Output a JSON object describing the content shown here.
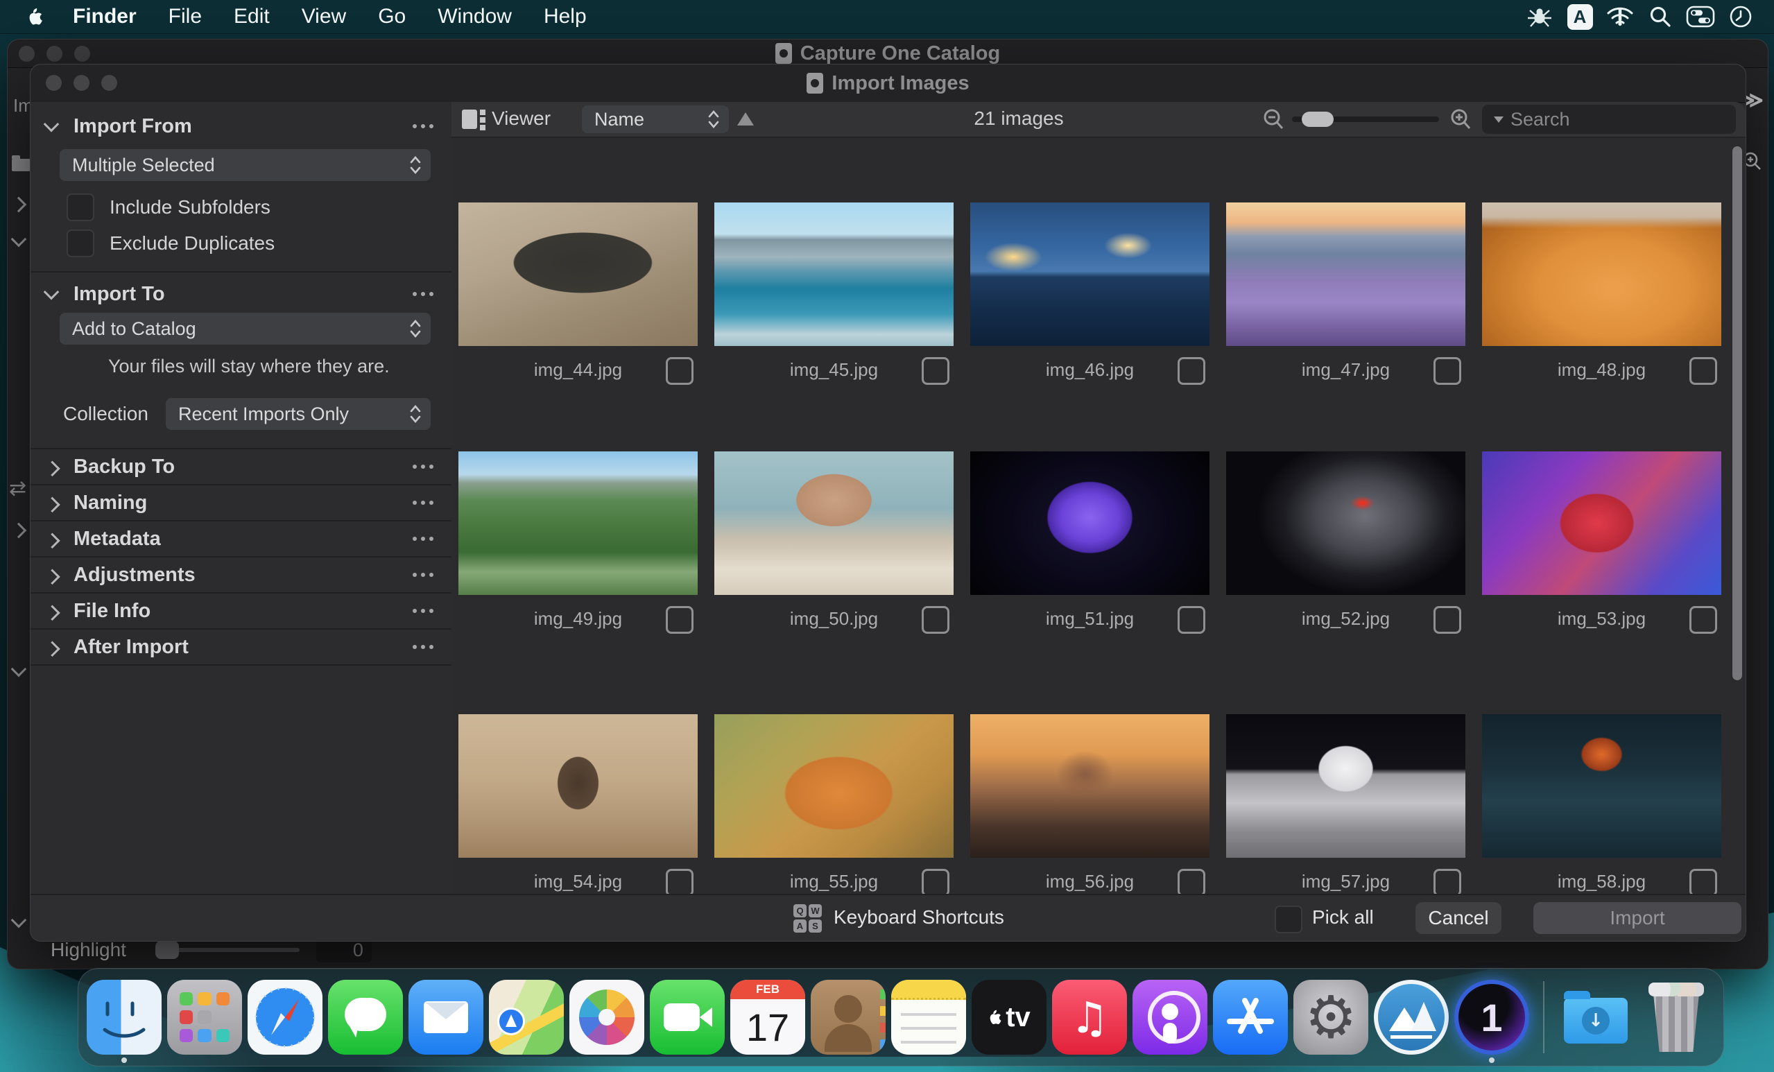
{
  "menu_bar": {
    "app_name": "Finder",
    "menus": [
      "File",
      "Edit",
      "View",
      "Go",
      "Window",
      "Help"
    ],
    "status_icons": [
      "drweb-spider-icon",
      "input-source-icon",
      "wifi-alert-icon",
      "spotlight-icon",
      "control-center-icon",
      "clock-icon"
    ]
  },
  "background_window": {
    "title": "Capture One Catalog",
    "left_rail_partial_label": "Im",
    "collapse_glyph": "≫",
    "swap_glyph": "⇄",
    "highlight": {
      "label": "Highlight",
      "value": "0"
    }
  },
  "dialog": {
    "title": "Import Images",
    "sidebar": {
      "import_from": {
        "title": "Import From",
        "source_value": "Multiple Selected",
        "include_subfolders_label": "Include Subfolders",
        "exclude_duplicates_label": "Exclude Duplicates"
      },
      "import_to": {
        "title": "Import To",
        "destination_value": "Add to Catalog",
        "note": "Your files will stay where they are.",
        "collection_label": "Collection",
        "collection_value": "Recent Imports Only"
      },
      "sections": [
        {
          "label": "Backup To"
        },
        {
          "label": "Naming"
        },
        {
          "label": "Metadata"
        },
        {
          "label": "Adjustments"
        },
        {
          "label": "File Info"
        },
        {
          "label": "After Import"
        }
      ]
    },
    "toolbar": {
      "viewer_label": "Viewer",
      "sort_by": "Name",
      "image_count": "21 images",
      "search_placeholder": "Search"
    },
    "grid": {
      "items": [
        {
          "name": "img_44.jpg",
          "bg": "radial-gradient(55% 40% at 52% 42%, #35332f 0%, #3a3833 52%, rgba(58,56,51,0) 53%), linear-gradient(160deg, #c3b49e 0%, #b3a38c 35%, #9b8a72 70%, #8a7960 100%)"
        },
        {
          "name": "img_45.jpg",
          "bg": "linear-gradient(180deg, #a8d8f0 0%, #c0e0ee 22%, #7f96a2 26%, #9fb4bd 38%, #5d98b0 48%, #1f7fa0 60%, #3c9ab8 78%, #bcd3da 92%, #9fc0ca 100%)"
        },
        {
          "name": "img_46.jpg",
          "bg": "radial-gradient(12% 10% at 18% 38%, #ffd98a 0%, rgba(255,217,138,0) 100%), radial-gradient(10% 9% at 66% 30%, #ffe2a0 0%, rgba(255,226,160,0) 100%), linear-gradient(180deg, #274e7e 0%, #3566a0 30%, #4878ae 48%, #1d3b60 52%, #142c4a 75%, #0e2138 100%)"
        },
        {
          "name": "img_47.jpg",
          "bg": "linear-gradient(180deg, #f2cf9f 0%, #edb683 14%, #8d9bb4 24%, #6f82a0 36%, #8f7cb8 55%, #9a86c6 70%, #7a64a4 86%, #5f4c86 100%)"
        },
        {
          "name": "img_48.jpg",
          "bg": "linear-gradient(180deg, #cdbfae 0%, #c9b7a2 10%, rgba(201,183,162,0) 18%), radial-gradient(70% 75% at 55% 60%, #eda04c 0%, #e08f3a 45%, #c47628 75%, #a95f1e 100%)"
        },
        {
          "name": "img_49.jpg",
          "bg": "linear-gradient(180deg, #8cc4e8 0%, #b8d8ec 16%, #8aa08e 22%, #5c8a54 34%, #49793f 52%, #3a6b33 70%, #86a878 84%, #557e48 100%)"
        },
        {
          "name": "img_50.jpg",
          "bg": "radial-gradient(26% 30% at 50% 34%, #caa183 0%, #b98e6f 60%, rgba(185,142,111,0) 61%), linear-gradient(180deg, #a3c2c8 0%, #8fb2ba 40%, #cabfae 62%, #e4dccd 82%, #d6cdbc 100%)"
        },
        {
          "name": "img_51.jpg",
          "bg": "radial-gradient(30% 42% at 50% 46%, #8a64f0 0%, #6a42d8 40%, #4a2aa8 58%, rgba(20,16,48,0) 60%), radial-gradient(60% 80% at 50% 50%, #181430 0%, #0a0818 55%, #030306 100%)"
        },
        {
          "name": "img_52.jpg",
          "bg": "radial-gradient(5% 5% at 57% 36%, #ff2a18 0%, rgba(255,42,24,0) 100%), radial-gradient(45% 55% at 58% 45%, #70707a 0%, #46464e 45%, #1c1c22 75%, #0a0a0e 100%)"
        },
        {
          "name": "img_53.jpg",
          "bg": "radial-gradient(30% 40% at 48% 50%, #e03a4a 0%, #b82838 50%, rgba(184,40,56,0) 52%), linear-gradient(130deg, #4a3ab8 0%, #8a3ac0 30%, #c04a78 55%, #5a4ac8 80%, #3a5ad8 100%)"
        },
        {
          "name": "img_54.jpg",
          "bg": "radial-gradient(14% 30% at 50% 48%, #4a3a2c 0%, #5a4636 60%, rgba(90,70,54,0) 62%), linear-gradient(180deg, #cdb697 0%, #c2a988 45%, #b39878 72%, #9d805e 100%)"
        },
        {
          "name": "img_55.jpg",
          "bg": "radial-gradient(40% 45% at 52% 55%, #e0883a 0%, #cc7830 55%, rgba(204,120,48,0) 57%), linear-gradient(140deg, #97a05c 0%, #b3a254 30%, #c9984a 55%, #b98a40 75%, #8a7038 100%)"
        },
        {
          "name": "img_56.jpg",
          "bg": "radial-gradient(20% 28% at 48% 42%, #8a5c42 0%, rgba(138,92,66,0) 60%), linear-gradient(180deg, #edb066 0%, #e09a52 28%, #9a6a48 52%, #4a352a 78%, #2a201a 100%)"
        },
        {
          "name": "img_57.jpg",
          "bg": "radial-gradient(20% 28% at 50% 38%, #f2f2f4 0%, #d8d8dc 55%, rgba(216,216,220,0) 58%), linear-gradient(180deg, #0a0a10 0%, #121218 38%, #9a9a9e 42%, #c4c4c8 62%, #8a8a8e 82%, #6f6f73 100%)"
        },
        {
          "name": "img_58.jpg",
          "bg": "radial-gradient(16% 22% at 50% 28%, #e06a2a 0%, #9a3c1a 50%, rgba(154,60,26,0) 55%), linear-gradient(180deg, #13232c 0%, #1a2f3a 35%, #23404c 60%, #152832 100%)"
        }
      ]
    },
    "footer": {
      "keyboard_shortcuts_label": "Keyboard Shortcuts",
      "pick_all_label": "Pick all",
      "cancel_label": "Cancel",
      "import_label": "Import"
    }
  },
  "dock": {
    "apps": [
      "finder",
      "launchpad",
      "safari",
      "messages",
      "mail",
      "maps",
      "photos",
      "facetime",
      "calendar",
      "contacts",
      "notes",
      "apple-tv",
      "music",
      "podcasts",
      "app-store",
      "system-settings",
      "app-cleaner",
      "capture-one",
      "downloads",
      "trash"
    ],
    "calendar": {
      "month": "FEB",
      "day": "17"
    },
    "apple_tv_label": "tv",
    "music_glyph": "♫",
    "capture_one_glyph": "1",
    "downloads_glyph": "↓",
    "settings_glyph": "⚙"
  },
  "colors": {
    "accent_teal": "#2b97a2",
    "dialog_bg": "#2b2b2d",
    "toolbar_bg": "#333335",
    "cancel_btn": "#404043",
    "import_btn_disabled": "#4a4a4e"
  }
}
